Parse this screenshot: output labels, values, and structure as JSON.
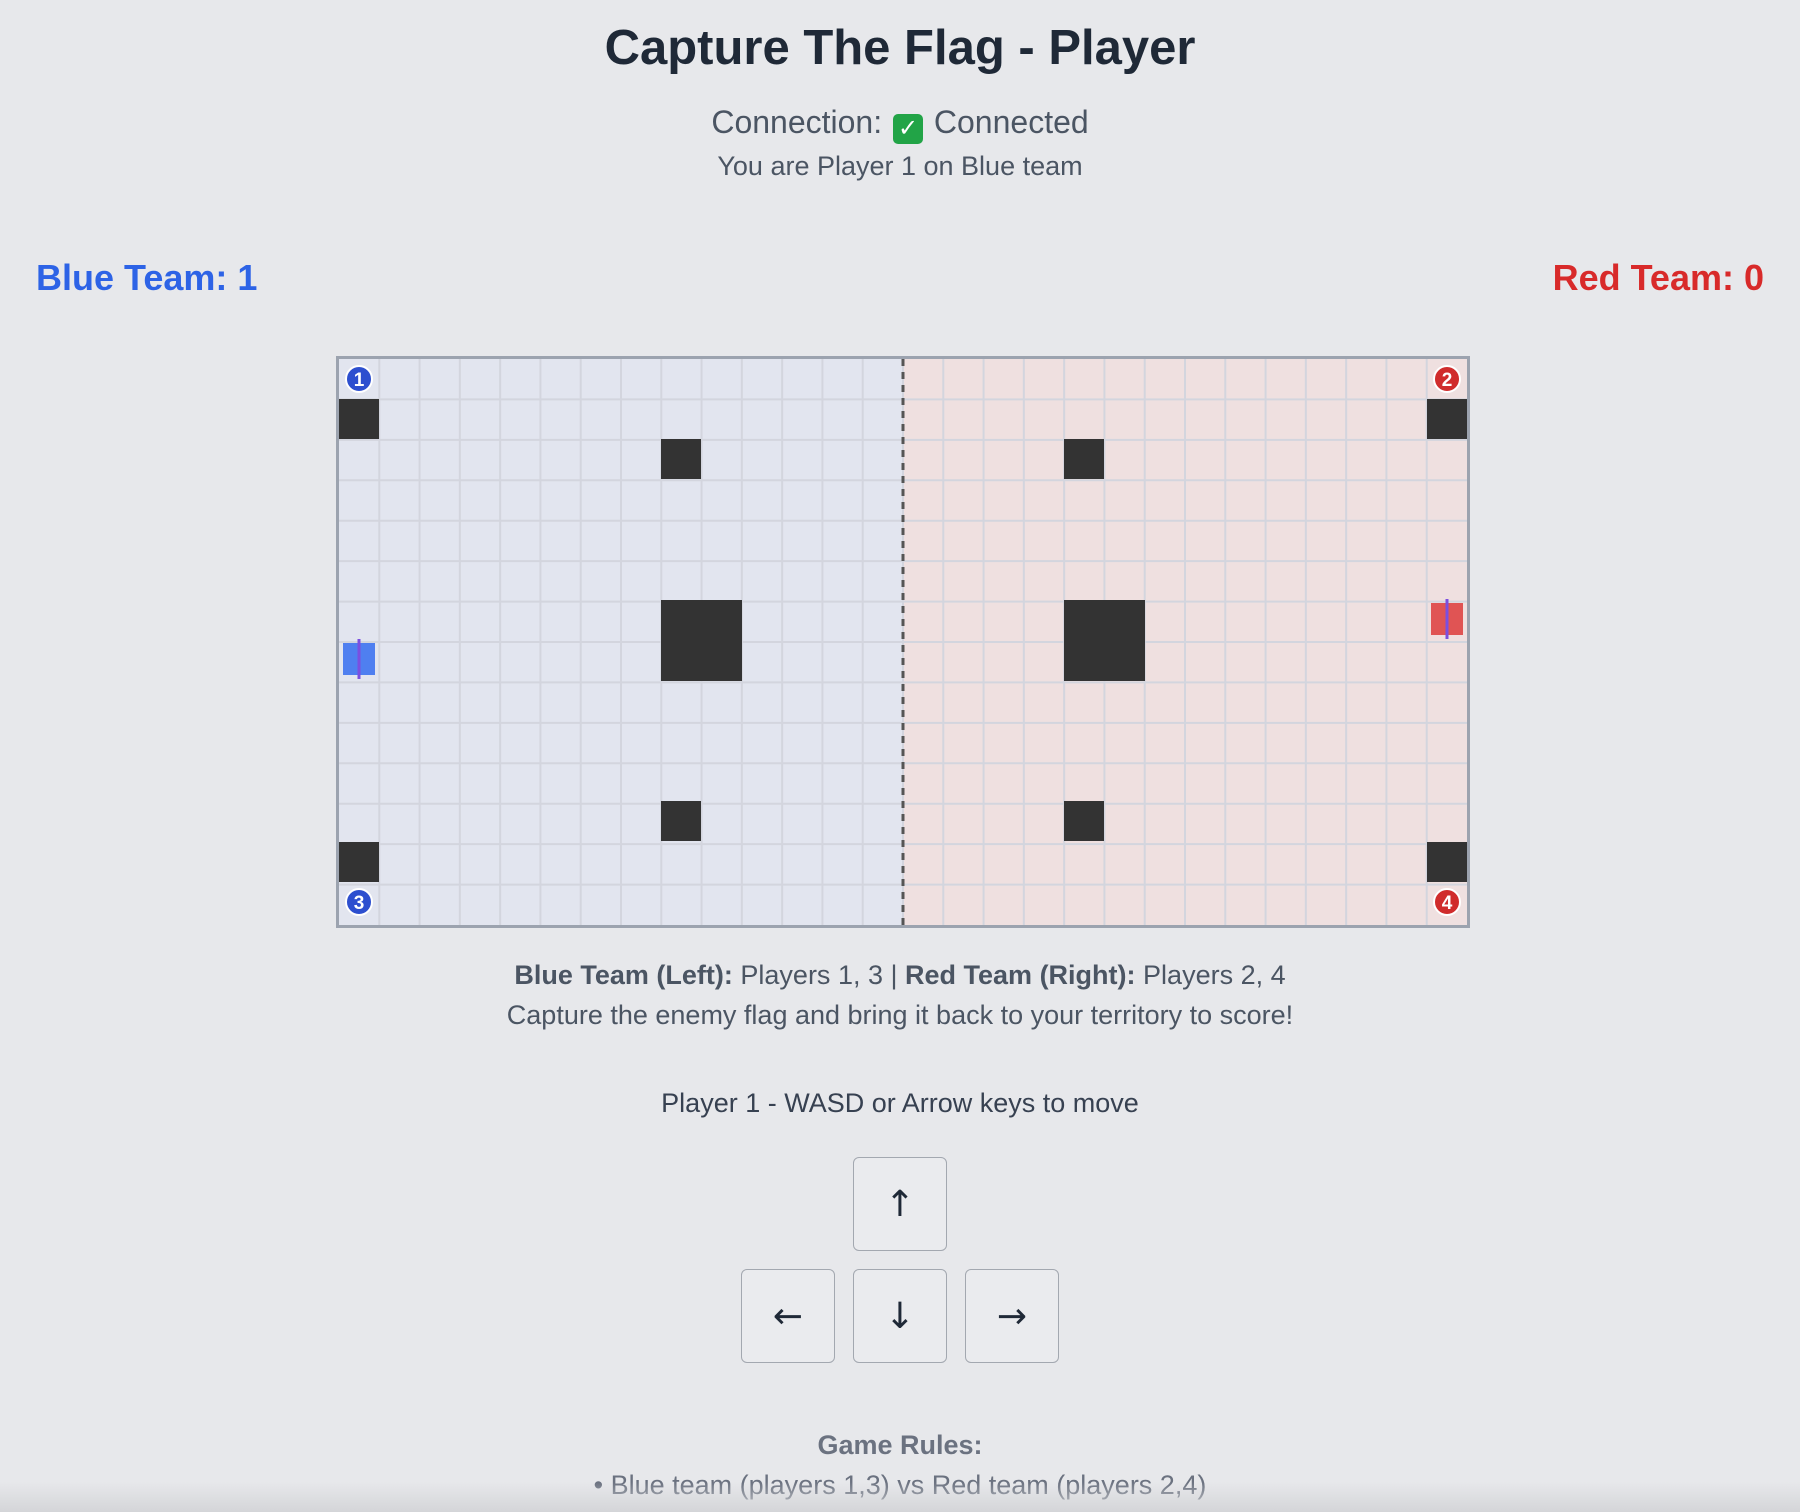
{
  "header": {
    "title": "Capture The Flag - Player",
    "connection_label": "Connection:",
    "connection_icon": "check-mark-icon",
    "connection_status": "Connected",
    "player_info": "You are Player 1 on Blue team"
  },
  "scores": {
    "blue_label": "Blue Team: 1",
    "red_label": "Red Team: 0",
    "blue_color": "#2d63e6",
    "red_color": "#d82a2a"
  },
  "board": {
    "cols": 28,
    "rows": 14,
    "blue_zone_color": "#e2e5ef",
    "red_zone_color": "#efe0e0",
    "obstacle_color": "#333333",
    "players": [
      {
        "number": "1",
        "team": "blue"
      },
      {
        "number": "2",
        "team": "red"
      },
      {
        "number": "3",
        "team": "blue"
      },
      {
        "number": "4",
        "team": "red"
      }
    ],
    "flags": [
      {
        "team": "blue",
        "color": "#4f7ff0"
      },
      {
        "team": "red",
        "color": "#e05454"
      }
    ]
  },
  "legend": {
    "blue_label": "Blue Team (Left):",
    "blue_players": "Players 1, 3",
    "separator": "|",
    "red_label": "Red Team (Right):",
    "red_players": "Players 2, 4",
    "objective": "Capture the enemy flag and bring it back to your territory to score!"
  },
  "controls": {
    "hint": "Player 1 - WASD or Arrow keys to move",
    "up": "↑",
    "left": "←",
    "down": "↓",
    "right": "→"
  },
  "rules": {
    "title": "Game Rules:",
    "items": [
      "• Blue team (players 1,3) vs Red team (players 2,4)"
    ]
  }
}
